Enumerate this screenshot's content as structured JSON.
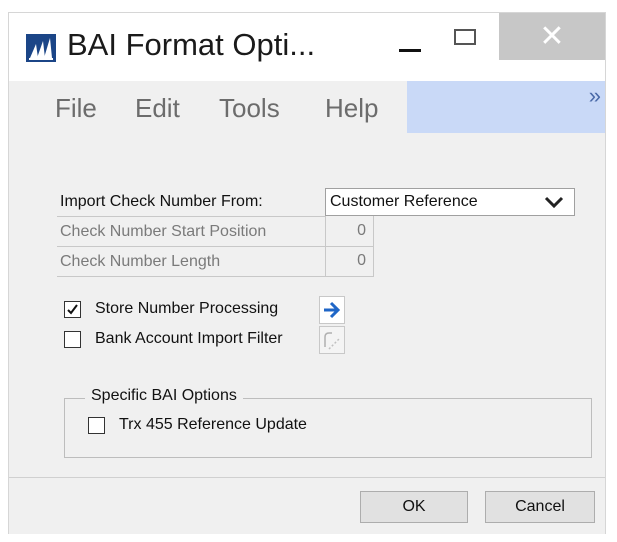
{
  "window": {
    "title": "BAI Format Opti...",
    "close_glyph": "✕"
  },
  "menu": {
    "items": [
      "File",
      "Edit",
      "Tools",
      "Help"
    ],
    "chevron": "»"
  },
  "form": {
    "import_check_label": "Import Check Number From:",
    "import_check_value": "Customer Reference",
    "start_position_label": "Check Number Start Position",
    "start_position_value": "0",
    "length_label": "Check Number Length",
    "length_value": "0",
    "store_number_label": "Store Number Processing",
    "store_number_checked": true,
    "bank_filter_label": "Bank Account Import Filter",
    "bank_filter_checked": false
  },
  "group": {
    "title": "Specific BAI Options",
    "trx455_label": "Trx 455 Reference Update",
    "trx455_checked": false
  },
  "buttons": {
    "ok": "OK",
    "cancel": "Cancel"
  },
  "colors": {
    "brand": "#1b4587",
    "menu_highlight": "#c9d9f7",
    "arrow_blue": "#1f66c7"
  },
  "icons": {
    "app": "bars-logo-icon",
    "arrow": "right-arrow-icon",
    "filter": "filter-icon",
    "check": "checkmark-icon",
    "dropdown": "chevron-down-icon"
  }
}
